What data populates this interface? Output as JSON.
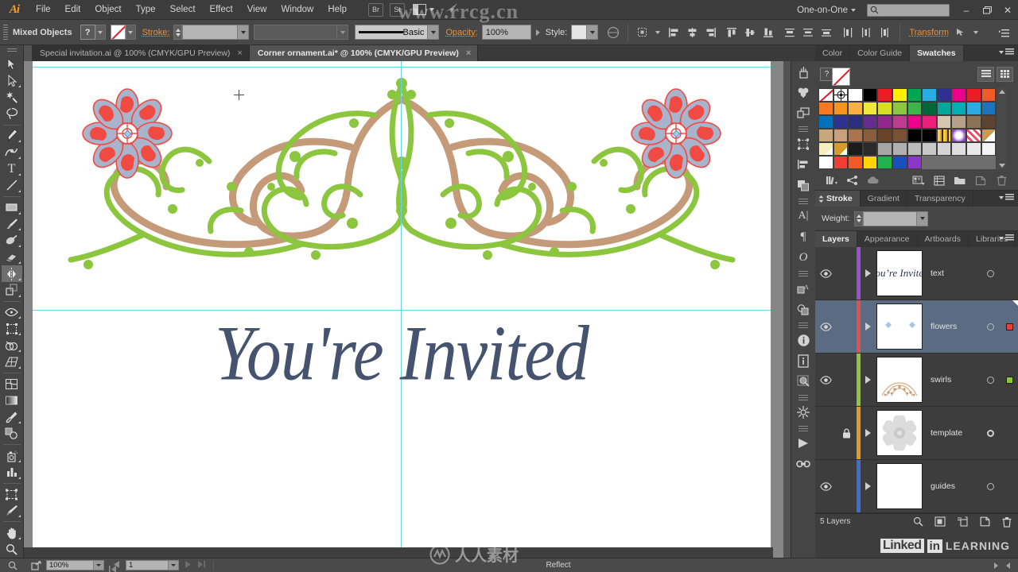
{
  "app": {
    "logo": "Ai",
    "title": "Adobe Illustrator"
  },
  "menubar": {
    "items": [
      "File",
      "Edit",
      "Object",
      "Type",
      "Select",
      "Effect",
      "View",
      "Window",
      "Help"
    ],
    "bridge_button": "Br",
    "stock_button": "St",
    "arrange_icon": "arrange-documents-icon",
    "home_icon": "illustrator-home-icon",
    "workspace": "One-on-One",
    "search_placeholder": "",
    "search_value": "",
    "window_buttons": {
      "minimize": "–",
      "restore": "❐",
      "close": "✕"
    }
  },
  "controlbar": {
    "selection_label": "Mixed Objects",
    "fill_swatch": "?",
    "stroke_swatch": "none-stroke-icon",
    "stroke_label": "Stroke:",
    "stroke_weight_value": "",
    "stroke_profile_value": "",
    "brush_label": "Basic",
    "opacity_label": "Opacity:",
    "opacity_value": "100%",
    "style_label": "Style:",
    "recolor_icon": "recolor-artwork-icon",
    "align_icons": [
      "align-left-icon",
      "align-horizontal-center-icon",
      "align-right-icon",
      "align-top-icon",
      "align-vertical-center-icon",
      "align-bottom-icon",
      "distribute-top-icon",
      "distribute-vertical-center-icon",
      "distribute-bottom-icon",
      "distribute-left-icon",
      "distribute-horizontal-center-icon",
      "distribute-right-icon"
    ],
    "selection_mode_icon": "select-similar-icon",
    "transform_label": "Transform",
    "anchor_icon": "anchor-point-icon",
    "extra_icon": "control-panel-options-icon"
  },
  "tabs": [
    {
      "label": "Special invitation.ai @ 100% (CMYK/GPU Preview)",
      "active": false,
      "close": "×"
    },
    {
      "label": "Corner ornament.ai* @ 100% (CMYK/GPU Preview)",
      "active": true,
      "close": "×"
    }
  ],
  "toolbar": {
    "tools": [
      {
        "name": "selection-tool",
        "glyph": "arrow-solid",
        "selected": false,
        "corner": false
      },
      {
        "name": "direct-selection-tool",
        "glyph": "arrow-white",
        "selected": false,
        "corner": true
      },
      {
        "name": "magic-wand-tool",
        "glyph": "magic-wand",
        "selected": false,
        "corner": false
      },
      {
        "name": "lasso-tool",
        "glyph": "lasso",
        "selected": false,
        "corner": false
      },
      {
        "name": "pen-tool",
        "glyph": "pen",
        "selected": false,
        "corner": true
      },
      {
        "name": "curvature-tool",
        "glyph": "curvature",
        "selected": false,
        "corner": false
      },
      {
        "name": "type-tool",
        "glyph": "type",
        "selected": false,
        "corner": true
      },
      {
        "name": "line-segment-tool",
        "glyph": "line",
        "selected": false,
        "corner": true
      },
      {
        "name": "rectangle-tool",
        "glyph": "rect",
        "selected": false,
        "corner": true
      },
      {
        "name": "paintbrush-tool",
        "glyph": "brush",
        "selected": false,
        "corner": true
      },
      {
        "name": "shaper-tool",
        "glyph": "shaper",
        "selected": false,
        "corner": true
      },
      {
        "name": "eraser-tool",
        "glyph": "eraser",
        "selected": false,
        "corner": true
      },
      {
        "name": "reflect-tool",
        "glyph": "reflect",
        "selected": true,
        "corner": true
      },
      {
        "name": "scale-tool",
        "glyph": "scale",
        "selected": false,
        "corner": true
      },
      {
        "name": "width-tool",
        "glyph": "width",
        "selected": false,
        "corner": true
      },
      {
        "name": "free-transform-tool",
        "glyph": "freetransform",
        "selected": false,
        "corner": true
      },
      {
        "name": "shape-builder-tool",
        "glyph": "shapebuilder",
        "selected": false,
        "corner": true
      },
      {
        "name": "perspective-grid-tool",
        "glyph": "perspective",
        "selected": false,
        "corner": true
      },
      {
        "name": "mesh-tool",
        "glyph": "mesh",
        "selected": false,
        "corner": false
      },
      {
        "name": "gradient-tool",
        "glyph": "gradient",
        "selected": false,
        "corner": false
      },
      {
        "name": "eyedropper-tool",
        "glyph": "eyedropper",
        "selected": false,
        "corner": true
      },
      {
        "name": "blend-tool",
        "glyph": "blend",
        "selected": false,
        "corner": false
      },
      {
        "name": "symbol-sprayer-tool",
        "glyph": "symbolsprayer",
        "selected": false,
        "corner": true
      },
      {
        "name": "column-graph-tool",
        "glyph": "graph",
        "selected": false,
        "corner": true
      },
      {
        "name": "artboard-tool",
        "glyph": "artboard",
        "selected": false,
        "corner": false
      },
      {
        "name": "slice-tool",
        "glyph": "slice",
        "selected": false,
        "corner": true
      },
      {
        "name": "hand-tool",
        "glyph": "hand",
        "selected": false,
        "corner": true
      },
      {
        "name": "zoom-tool",
        "glyph": "zoom",
        "selected": false,
        "corner": false
      }
    ]
  },
  "canvas": {
    "artwork_title": "You're Invited",
    "text_color": "#46536e",
    "swirl_green": "#8cc63e",
    "swirl_tan": "#c49a78",
    "flower_red": "#f04a42",
    "flower_blue": "#a8b4cc",
    "guide_color": "#5fd9e8",
    "cursor_icon": "crosshair-cursor"
  },
  "rail": {
    "groups": [
      [
        "brush-libraries-icon",
        "symbols-icon",
        "artboards-panel-icon"
      ],
      [
        "transform-panel-icon",
        "align-panel-icon",
        "pathfinder-panel-icon"
      ],
      [
        "character-panel-icon",
        "paragraph-panel-icon",
        "opentype-panel-icon"
      ],
      [
        "graphic-styles-icon",
        "appearance-icon"
      ],
      [
        "info-panel-icon",
        "document-info-icon",
        "separations-preview-icon"
      ],
      [
        "asset-export-icon"
      ],
      [
        "actions-panel-icon",
        "links-panel-icon"
      ]
    ]
  },
  "panels": {
    "color_group": {
      "tabs": [
        "Color",
        "Color Guide",
        "Swatches"
      ],
      "active_tab": "Swatches",
      "help_button": "?",
      "none_swatch": "none-color-icon",
      "view_list_icon": "list-view-icon",
      "view_grid_icon": "grid-view-icon",
      "footer_icons": [
        "swatch-libraries-icon",
        "color-group-icon",
        "cloud-libraries-icon",
        "show-swatch-kinds-icon",
        "swatch-options-icon",
        "new-color-group-icon",
        "new-swatch-icon",
        "delete-swatch-icon"
      ],
      "swatch_rows": [
        [
          "none",
          "registration",
          "#ffffff",
          "#000000",
          "#ed1c24",
          "#ffef00",
          "#00a651",
          "#29abe2",
          "#2e3192",
          "#ec008c",
          "#ed1c24",
          "#f15a29"
        ],
        [
          "#f47920",
          "#f7941e",
          "#fbb040",
          "#eeea36",
          "#d7df23",
          "#8dc63f",
          "#39b54a",
          "#006838",
          "#00a79d",
          "#00aeb3",
          "#29abe2",
          "#1c75bc"
        ],
        [
          "#0071bc",
          "#2e3192",
          "#2b2d7f",
          "#662d91",
          "#92278f",
          "#bf3b8f",
          "#ec008c",
          "#ed1e79",
          "#d6c6ae",
          "#b5a08a",
          "#8c7256",
          "#5c4433"
        ],
        [
          "#c9a77c",
          "#c8a07a",
          "#a9754f",
          "#8a5c38",
          "#6b4326",
          "#7a5133",
          "#000000",
          "#000000",
          "#e8c83c",
          "#f2f2f2",
          "#f0c0c8",
          "#c99a4d"
        ],
        [
          "#f4eec0",
          "#d79b2a",
          "#1b1b1b",
          "#2a2a2a",
          "#a5a5a5",
          "#b0b0b0",
          "#bcbcbc",
          "#c8c8c8",
          "#d4d4d4",
          "#dedede",
          "#e9e9e9",
          "#f4f4f4"
        ],
        [
          "#ffffff",
          "#ef3e36",
          "#f15a24",
          "#ffd400",
          "#22b14c",
          "#1b4fc0",
          "#8b35c9",
          "",
          "",
          "",
          "",
          ""
        ]
      ]
    },
    "stroke_group": {
      "tabs": [
        "Stroke",
        "Gradient",
        "Transparency"
      ],
      "active_tab": "Stroke",
      "weight_label": "Weight:",
      "weight_value": ""
    },
    "layers_group": {
      "tabs": [
        "Layers",
        "Appearance",
        "Artboards",
        "Libraries"
      ],
      "active_tab": "Layers",
      "rows": [
        {
          "name": "text",
          "visible": true,
          "locked": false,
          "color": "#9b4fd8",
          "selected": false,
          "has_selection_square": false,
          "sel_color": "",
          "thumb": "script-text-thumb",
          "target": "single"
        },
        {
          "name": "flowers",
          "visible": true,
          "locked": false,
          "color": "#d9534f",
          "selected": true,
          "has_selection_square": true,
          "sel_color": "#ef3e36",
          "thumb": "flowers-thumb",
          "target": "single"
        },
        {
          "name": "swirls",
          "visible": true,
          "locked": false,
          "color": "#8cc63e",
          "selected": false,
          "has_selection_square": true,
          "sel_color": "#8cc63e",
          "thumb": "swirls-thumb",
          "target": "single"
        },
        {
          "name": "template",
          "visible": false,
          "locked": true,
          "color": "#e09a2e",
          "selected": false,
          "has_selection_square": false,
          "sel_color": "",
          "thumb": "template-thumb",
          "target": "double"
        },
        {
          "name": "guides",
          "visible": true,
          "locked": false,
          "color": "#3f6fd0",
          "selected": false,
          "has_selection_square": false,
          "sel_color": "",
          "thumb": "blank-thumb",
          "target": "single"
        }
      ],
      "footer_count": "5 Layers",
      "footer_icons": [
        "locate-object-icon",
        "make-clipping-mask-icon",
        "create-new-sublayer-icon",
        "create-new-layer-icon",
        "delete-selection-icon"
      ]
    }
  },
  "statusbar": {
    "zoom_value": "100%",
    "artboard_value": "1",
    "status_text": "Reflect",
    "search_icon": "search-icon",
    "share_icon": "share-document-icon",
    "nav_first": "first-artboard-icon",
    "nav_prev": "previous-artboard-icon",
    "nav_next": "next-artboard-icon",
    "nav_last": "last-artboard-icon"
  },
  "watermarks": {
    "site": "www.rrcg.cn",
    "linkedin_in": "in",
    "linkedin_word": "Linked",
    "linkedin_learning": "LEARNING",
    "center_text": "人人素材"
  }
}
